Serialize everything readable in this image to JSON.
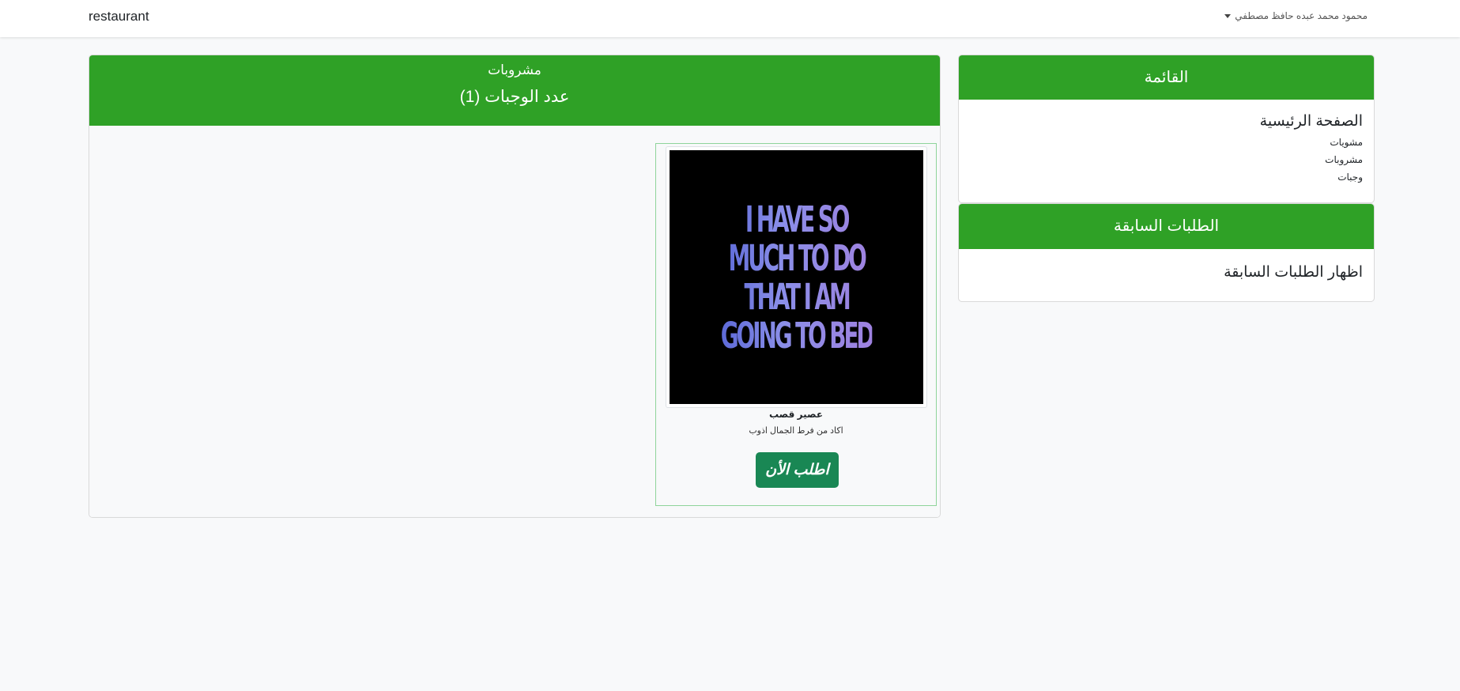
{
  "navbar": {
    "brand": "restaurant",
    "user_name": "محمود محمد عبده حافظ مصطفي"
  },
  "sidebar": {
    "menu_title": "القائمة",
    "home_link": "الصفحة الرئيسية",
    "links": [
      "مشويات",
      "مشروبات",
      "وجبات"
    ],
    "orders_title": "الطلبات السابقة",
    "orders_link": "اظهار الطلبات السابقة"
  },
  "category": {
    "title": "مشروبات",
    "meal_count": "عدد الوجبات (1)"
  },
  "items": [
    {
      "image_text_lines": [
        "I HAVE SO",
        "MUCH TO DO",
        "THAT I AM",
        "GOING TO BED"
      ],
      "name": "عصير قصب",
      "description": "اكاد من فرط الجمال اذوب",
      "order_label": "اطلب الأن"
    }
  ],
  "colors": {
    "header_green": "#2fa126",
    "button_green": "#198754",
    "item_border": "#8fd49a"
  }
}
